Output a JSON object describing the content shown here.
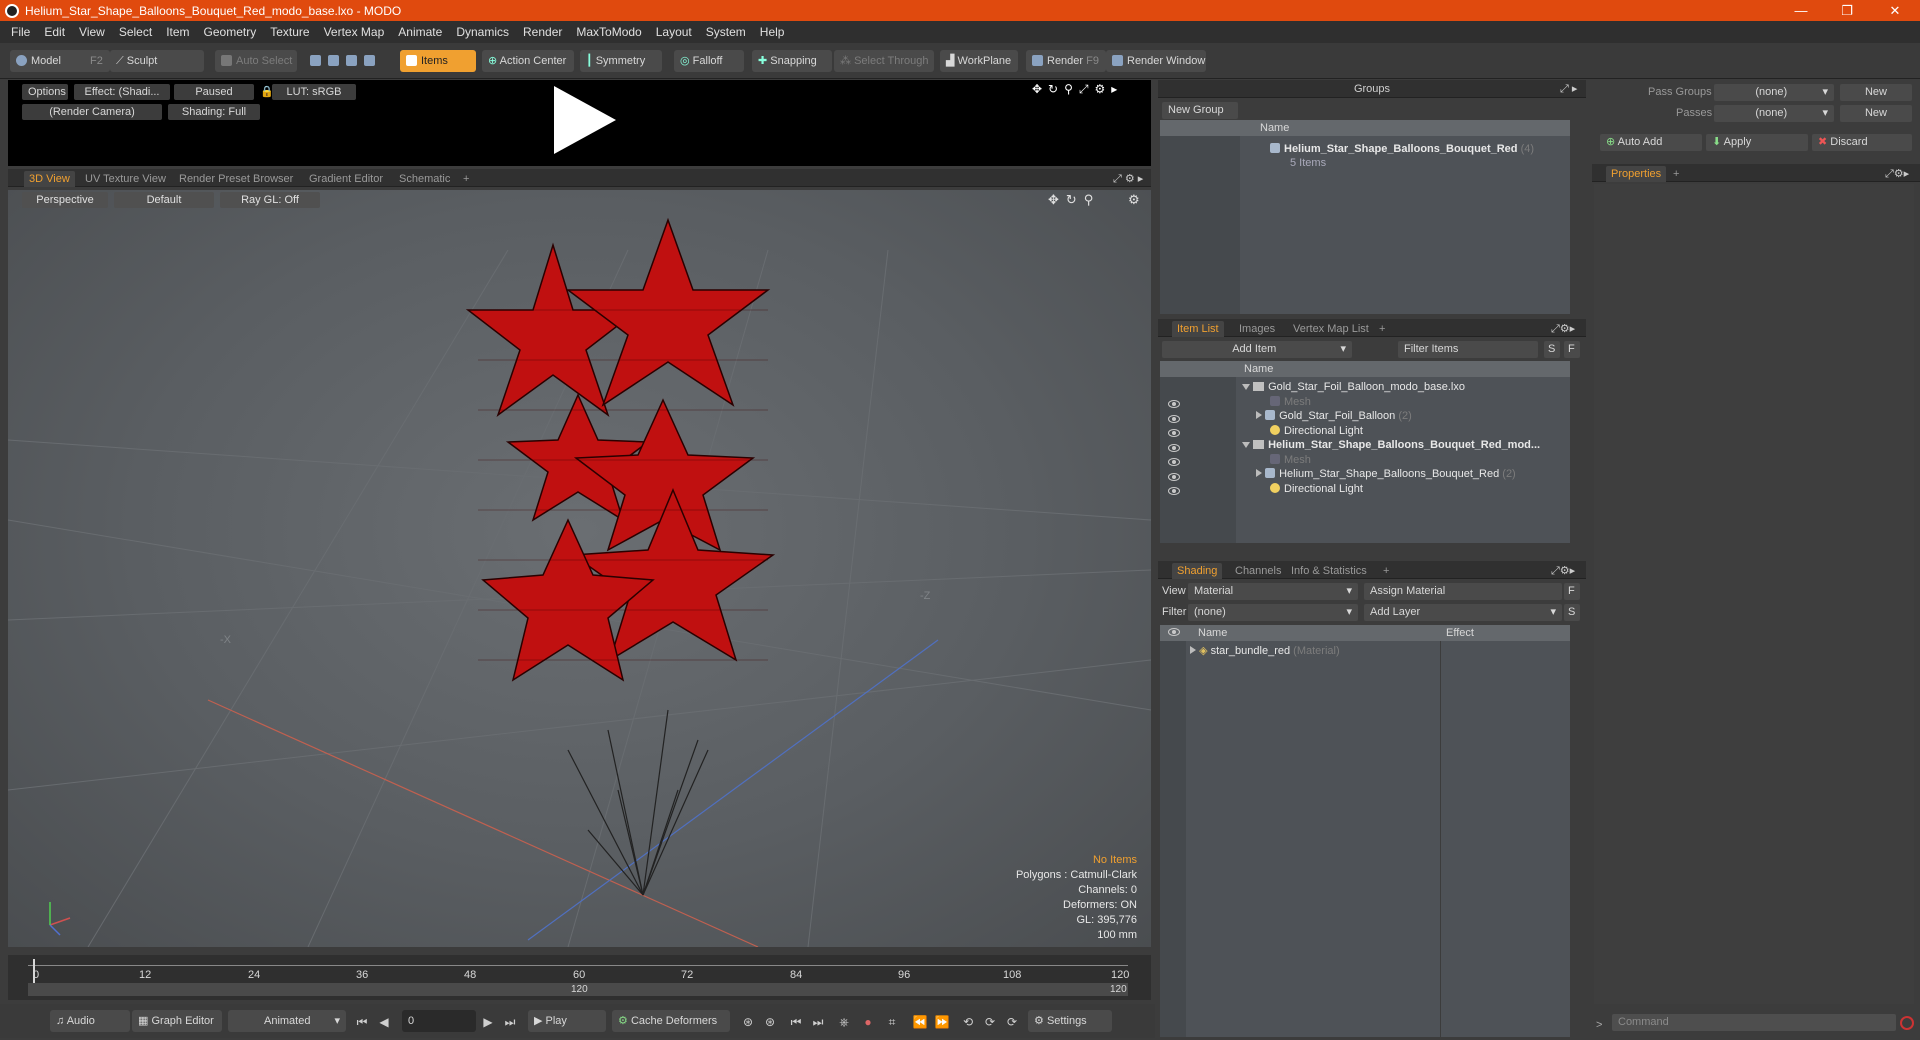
{
  "window": {
    "title": "Helium_Star_Shape_Balloons_Bouquet_Red_modo_base.lxo - MODO",
    "minimize": "—",
    "maximize": "❐",
    "close": "✕"
  },
  "menu": [
    "File",
    "Edit",
    "View",
    "Select",
    "Item",
    "Geometry",
    "Texture",
    "Vertex Map",
    "Animate",
    "Dynamics",
    "Render",
    "MaxToModo",
    "Layout",
    "System",
    "Help"
  ],
  "toolbar": {
    "model": "Model",
    "model_key": "F2",
    "sculpt": "Sculpt",
    "auto_select": "Auto Select",
    "items": "Items",
    "action_center": "Action Center",
    "symmetry": "Symmetry",
    "falloff": "Falloff",
    "snapping": "Snapping",
    "select_through": "Select Through",
    "workplane": "WorkPlane",
    "render": "Render",
    "render_key": "F9",
    "render_window": "Render Window"
  },
  "preview": {
    "options": "Options",
    "effect": "Effect: (Shadi...",
    "paused": "Paused",
    "lut": "LUT: sRGB",
    "camera": "(Render Camera)",
    "shading": "Shading: Full"
  },
  "viewport_tabs": [
    "3D View",
    "UV Texture View",
    "Render Preset Browser",
    "Gradient Editor",
    "Schematic",
    "+"
  ],
  "viewport": {
    "projection": "Perspective",
    "style": "Default",
    "raygl": "Ray GL: Off",
    "axis_x": "-X",
    "axis_z": "-Z",
    "hud": {
      "selection": "No Items",
      "polygons": "Polygons : Catmull-Clark",
      "channels": "Channels: 0",
      "deformers": "Deformers: ON",
      "gl": "GL: 395,776",
      "scale": "100 mm"
    }
  },
  "timeline": {
    "ticks": [
      "0",
      "12",
      "24",
      "36",
      "48",
      "60",
      "72",
      "84",
      "96",
      "108",
      "120"
    ],
    "range_mid": "120",
    "range_end": "120"
  },
  "bottombar": {
    "audio": "Audio",
    "graph_editor": "Graph Editor",
    "animated": "Animated",
    "frame": "0",
    "play": "Play",
    "cache_deformers": "Cache Deformers",
    "settings": "Settings"
  },
  "groups": {
    "title": "Groups",
    "new_group": "New Group",
    "col_name": "Name",
    "item_name": "Helium_Star_Shape_Balloons_Bouquet_Red",
    "item_count": "(4)",
    "item_sub": "5 Items"
  },
  "item_list": {
    "tabs": [
      "Item List",
      "Images",
      "Vertex Map List",
      "+"
    ],
    "add_item": "Add Item",
    "filter": "Filter Items",
    "s": "S",
    "f": "F",
    "col_name": "Name",
    "rows": [
      {
        "text": "Gold_Star_Foil_Balloon_modo_base.lxo",
        "extra": ""
      },
      {
        "text": "Mesh",
        "extra": ""
      },
      {
        "text": "Gold_Star_Foil_Balloon",
        "extra": "(2)"
      },
      {
        "text": "Directional Light",
        "extra": ""
      },
      {
        "text": "Helium_Star_Shape_Balloons_Bouquet_Red_mod...",
        "extra": ""
      },
      {
        "text": "Mesh",
        "extra": ""
      },
      {
        "text": "Helium_Star_Shape_Balloons_Bouquet_Red",
        "extra": "(2)"
      },
      {
        "text": "Directional Light",
        "extra": ""
      }
    ]
  },
  "shading": {
    "tabs": [
      "Shading",
      "Channels",
      "Info & Statistics",
      "+"
    ],
    "view_label": "View",
    "view_value": "Material",
    "assign_material": "Assign Material",
    "filter_label": "Filter",
    "filter_value": "(none)",
    "add_layer": "Add Layer",
    "f": "F",
    "s": "S",
    "col_name": "Name",
    "col_effect": "Effect",
    "row_name": "star_bundle_red",
    "row_type": "(Material)"
  },
  "passes": {
    "pass_groups_label": "Pass Groups",
    "pass_groups_value": "(none)",
    "new1": "New",
    "passes_label": "Passes",
    "passes_value": "(none)",
    "new2": "New",
    "auto_add": "Auto Add",
    "apply": "Apply",
    "discard": "Discard",
    "properties": "Properties",
    "plus": "+",
    "command": "Command"
  }
}
